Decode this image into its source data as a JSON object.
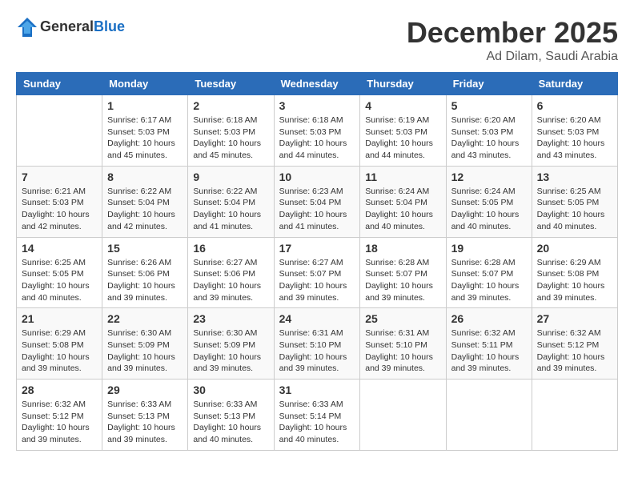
{
  "header": {
    "logo_general": "General",
    "logo_blue": "Blue",
    "month": "December 2025",
    "location": "Ad Dilam, Saudi Arabia"
  },
  "columns": [
    "Sunday",
    "Monday",
    "Tuesday",
    "Wednesday",
    "Thursday",
    "Friday",
    "Saturday"
  ],
  "weeks": [
    [
      {
        "day": "",
        "info": ""
      },
      {
        "day": "1",
        "info": "Sunrise: 6:17 AM\nSunset: 5:03 PM\nDaylight: 10 hours\nand 45 minutes."
      },
      {
        "day": "2",
        "info": "Sunrise: 6:18 AM\nSunset: 5:03 PM\nDaylight: 10 hours\nand 45 minutes."
      },
      {
        "day": "3",
        "info": "Sunrise: 6:18 AM\nSunset: 5:03 PM\nDaylight: 10 hours\nand 44 minutes."
      },
      {
        "day": "4",
        "info": "Sunrise: 6:19 AM\nSunset: 5:03 PM\nDaylight: 10 hours\nand 44 minutes."
      },
      {
        "day": "5",
        "info": "Sunrise: 6:20 AM\nSunset: 5:03 PM\nDaylight: 10 hours\nand 43 minutes."
      },
      {
        "day": "6",
        "info": "Sunrise: 6:20 AM\nSunset: 5:03 PM\nDaylight: 10 hours\nand 43 minutes."
      }
    ],
    [
      {
        "day": "7",
        "info": "Sunrise: 6:21 AM\nSunset: 5:03 PM\nDaylight: 10 hours\nand 42 minutes."
      },
      {
        "day": "8",
        "info": "Sunrise: 6:22 AM\nSunset: 5:04 PM\nDaylight: 10 hours\nand 42 minutes."
      },
      {
        "day": "9",
        "info": "Sunrise: 6:22 AM\nSunset: 5:04 PM\nDaylight: 10 hours\nand 41 minutes."
      },
      {
        "day": "10",
        "info": "Sunrise: 6:23 AM\nSunset: 5:04 PM\nDaylight: 10 hours\nand 41 minutes."
      },
      {
        "day": "11",
        "info": "Sunrise: 6:24 AM\nSunset: 5:04 PM\nDaylight: 10 hours\nand 40 minutes."
      },
      {
        "day": "12",
        "info": "Sunrise: 6:24 AM\nSunset: 5:05 PM\nDaylight: 10 hours\nand 40 minutes."
      },
      {
        "day": "13",
        "info": "Sunrise: 6:25 AM\nSunset: 5:05 PM\nDaylight: 10 hours\nand 40 minutes."
      }
    ],
    [
      {
        "day": "14",
        "info": "Sunrise: 6:25 AM\nSunset: 5:05 PM\nDaylight: 10 hours\nand 40 minutes."
      },
      {
        "day": "15",
        "info": "Sunrise: 6:26 AM\nSunset: 5:06 PM\nDaylight: 10 hours\nand 39 minutes."
      },
      {
        "day": "16",
        "info": "Sunrise: 6:27 AM\nSunset: 5:06 PM\nDaylight: 10 hours\nand 39 minutes."
      },
      {
        "day": "17",
        "info": "Sunrise: 6:27 AM\nSunset: 5:07 PM\nDaylight: 10 hours\nand 39 minutes."
      },
      {
        "day": "18",
        "info": "Sunrise: 6:28 AM\nSunset: 5:07 PM\nDaylight: 10 hours\nand 39 minutes."
      },
      {
        "day": "19",
        "info": "Sunrise: 6:28 AM\nSunset: 5:07 PM\nDaylight: 10 hours\nand 39 minutes."
      },
      {
        "day": "20",
        "info": "Sunrise: 6:29 AM\nSunset: 5:08 PM\nDaylight: 10 hours\nand 39 minutes."
      }
    ],
    [
      {
        "day": "21",
        "info": "Sunrise: 6:29 AM\nSunset: 5:08 PM\nDaylight: 10 hours\nand 39 minutes."
      },
      {
        "day": "22",
        "info": "Sunrise: 6:30 AM\nSunset: 5:09 PM\nDaylight: 10 hours\nand 39 minutes."
      },
      {
        "day": "23",
        "info": "Sunrise: 6:30 AM\nSunset: 5:09 PM\nDaylight: 10 hours\nand 39 minutes."
      },
      {
        "day": "24",
        "info": "Sunrise: 6:31 AM\nSunset: 5:10 PM\nDaylight: 10 hours\nand 39 minutes."
      },
      {
        "day": "25",
        "info": "Sunrise: 6:31 AM\nSunset: 5:10 PM\nDaylight: 10 hours\nand 39 minutes."
      },
      {
        "day": "26",
        "info": "Sunrise: 6:32 AM\nSunset: 5:11 PM\nDaylight: 10 hours\nand 39 minutes."
      },
      {
        "day": "27",
        "info": "Sunrise: 6:32 AM\nSunset: 5:12 PM\nDaylight: 10 hours\nand 39 minutes."
      }
    ],
    [
      {
        "day": "28",
        "info": "Sunrise: 6:32 AM\nSunset: 5:12 PM\nDaylight: 10 hours\nand 39 minutes."
      },
      {
        "day": "29",
        "info": "Sunrise: 6:33 AM\nSunset: 5:13 PM\nDaylight: 10 hours\nand 39 minutes."
      },
      {
        "day": "30",
        "info": "Sunrise: 6:33 AM\nSunset: 5:13 PM\nDaylight: 10 hours\nand 40 minutes."
      },
      {
        "day": "31",
        "info": "Sunrise: 6:33 AM\nSunset: 5:14 PM\nDaylight: 10 hours\nand 40 minutes."
      },
      {
        "day": "",
        "info": ""
      },
      {
        "day": "",
        "info": ""
      },
      {
        "day": "",
        "info": ""
      }
    ]
  ]
}
